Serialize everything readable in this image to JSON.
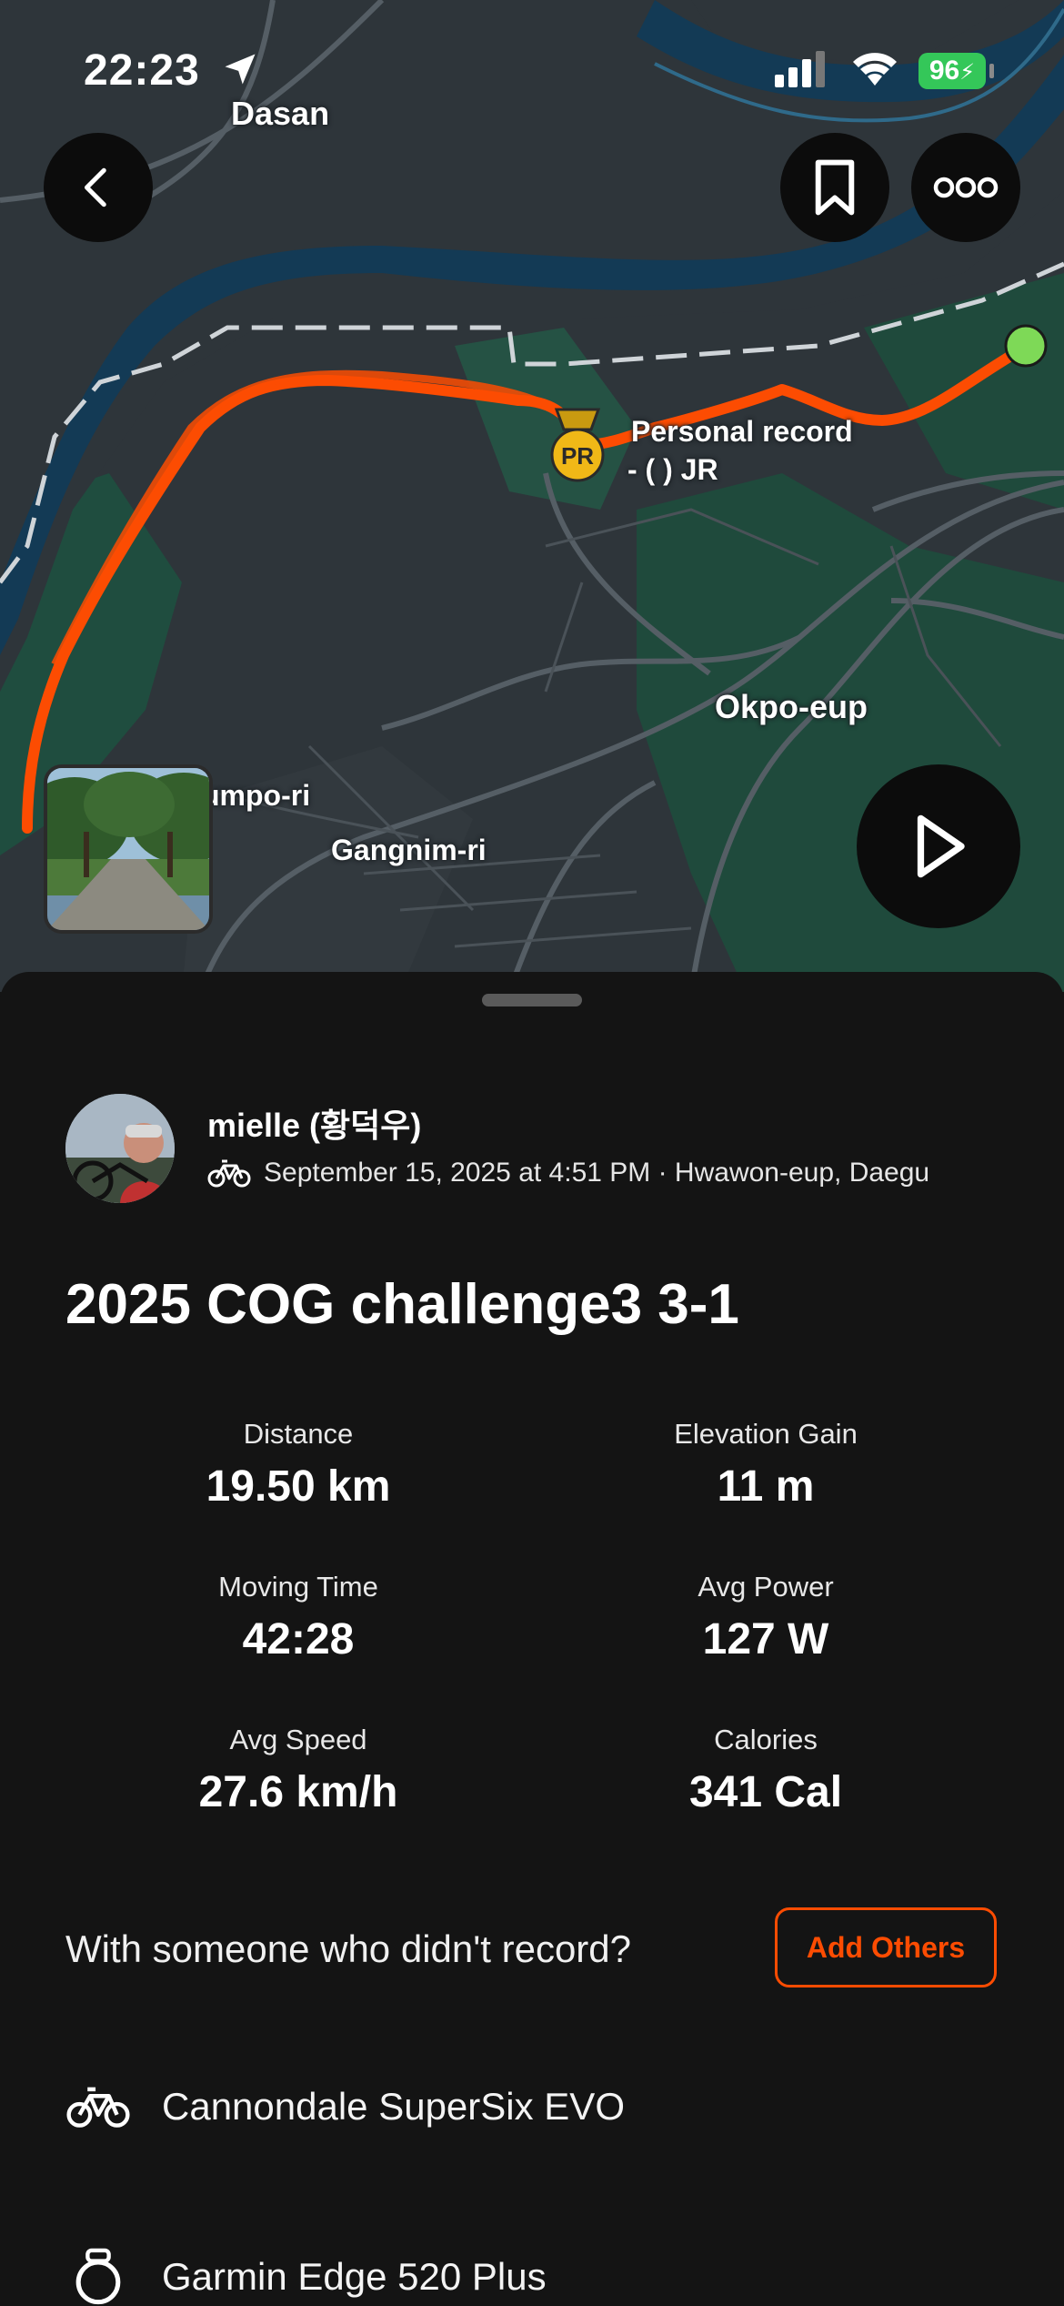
{
  "status_bar": {
    "time": "22:23",
    "battery": "96"
  },
  "map": {
    "labels": {
      "dasan": "Dasan",
      "okpo": "Okpo-eup",
      "gangnim": "Gangnim-ri",
      "umpo": "umpo-ri"
    },
    "pr_badge": "PR",
    "pr_title": "Personal record",
    "pr_subtitle": "-  ( ) JR"
  },
  "activity": {
    "athlete_name": "mielle (황덕우)",
    "date_location": "September 15, 2025 at 4:51 PM · Hwawon-eup, Daegu",
    "title": "2025 COG challenge3 3-1"
  },
  "stats": [
    {
      "label": "Distance",
      "value": "19.50 km"
    },
    {
      "label": "Elevation Gain",
      "value": "11 m"
    },
    {
      "label": "Moving Time",
      "value": "42:28"
    },
    {
      "label": "Avg Power",
      "value": "127 W"
    },
    {
      "label": "Avg Speed",
      "value": "27.6 km/h"
    },
    {
      "label": "Calories",
      "value": "341 Cal"
    }
  ],
  "with_others": {
    "prompt": "With someone who didn't record?",
    "button": "Add Others"
  },
  "gear": {
    "bike": "Cannondale SuperSix EVO",
    "device": "Garmin Edge 520 Plus"
  },
  "colors": {
    "accent": "#fc4c02",
    "start_dot": "#7ed957",
    "battery": "#34c759"
  }
}
